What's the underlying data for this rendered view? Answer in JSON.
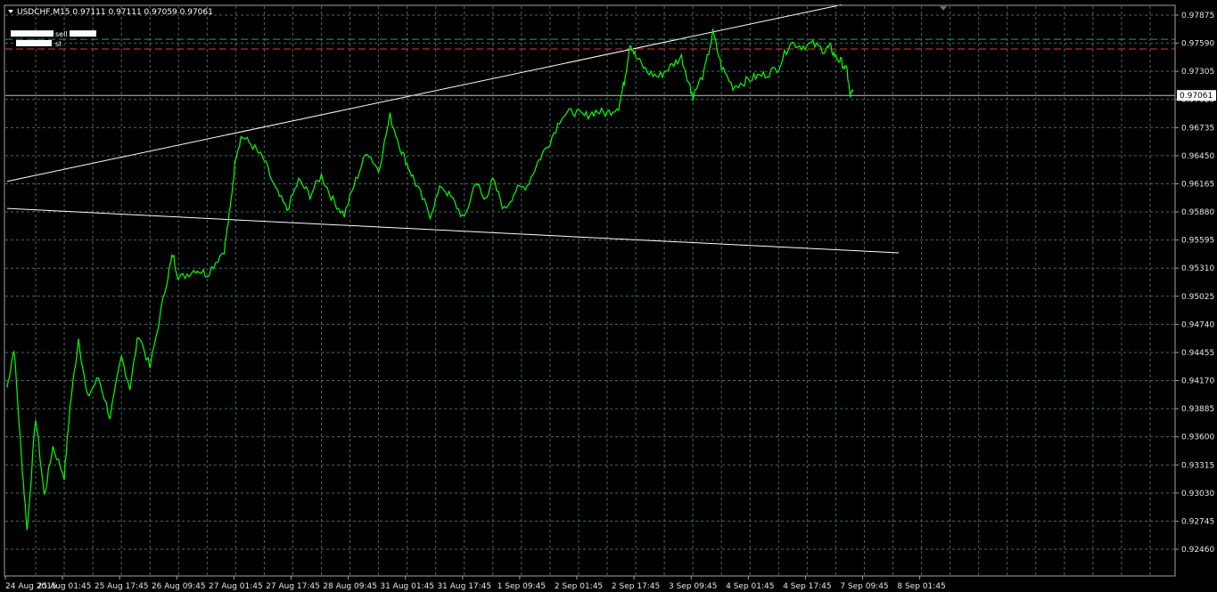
{
  "header": {
    "symbol_line": "USDCHF,M15  0.97111 0.97111 0.97059 0.97061"
  },
  "orders": [
    {
      "label": "sell",
      "price": 0.9763,
      "color": "#00b050"
    },
    {
      "label": "sl",
      "price": 0.97532,
      "color": "#d93b3b"
    }
  ],
  "current_price": {
    "label": "0.97061",
    "value": 0.97061,
    "color": "#ffffff"
  },
  "colors": {
    "background": "#000000",
    "grid": "#3f6b6b",
    "price": "#00ff00",
    "axis_text": "#e6e6e6"
  },
  "icons": [
    "dropdown-triangle-icon"
  ],
  "chart_data": {
    "type": "line",
    "title": "",
    "xlabel": "",
    "ylabel": "",
    "ylim": [
      0.9246,
      0.97875
    ],
    "grid": true,
    "y_ticks": [
      "0.97875",
      "0.97590",
      "0.97305",
      "0.97020",
      "0.96735",
      "0.96450",
      "0.96165",
      "0.95880",
      "0.95595",
      "0.95310",
      "0.95025",
      "0.94740",
      "0.94455",
      "0.94170",
      "0.93885",
      "0.93600",
      "0.93315",
      "0.93030",
      "0.92745",
      "0.92460"
    ],
    "x_ticks": [
      "24 Aug 2015",
      "25 Aug 01:45",
      "25 Aug 17:45",
      "26 Aug 09:45",
      "27 Aug 01:45",
      "27 Aug 17:45",
      "28 Aug 09:45",
      "31 Aug 01:45",
      "31 Aug 17:45",
      "1 Sep 09:45",
      "2 Sep 01:45",
      "2 Sep 17:45",
      "3 Sep 09:45",
      "4 Sep 01:45",
      "4 Sep 17:45",
      "7 Sep 09:45",
      "8 Sep 01:45"
    ],
    "series": [
      {
        "points": [
          [
            0,
            0.941
          ],
          [
            0.12,
            0.945
          ],
          [
            0.25,
            0.934
          ],
          [
            0.35,
            0.9265
          ],
          [
            0.5,
            0.938
          ],
          [
            0.65,
            0.93
          ],
          [
            0.8,
            0.935
          ],
          [
            1.0,
            0.932
          ],
          [
            1.1,
            0.939
          ],
          [
            1.25,
            0.946
          ],
          [
            1.4,
            0.94
          ],
          [
            1.6,
            0.942
          ],
          [
            1.8,
            0.938
          ],
          [
            2.0,
            0.944
          ],
          [
            2.15,
            0.941
          ],
          [
            2.3,
            0.9465
          ],
          [
            2.5,
            0.943
          ],
          [
            2.8,
            0.952
          ],
          [
            2.9,
            0.9545
          ],
          [
            3.0,
            0.952
          ],
          [
            3.3,
            0.953
          ],
          [
            3.5,
            0.9525
          ],
          [
            3.8,
            0.955
          ],
          [
            3.9,
            0.959
          ],
          [
            4.0,
            0.9645
          ],
          [
            4.1,
            0.9665
          ],
          [
            4.3,
            0.9655
          ],
          [
            4.5,
            0.964
          ],
          [
            4.7,
            0.961
          ],
          [
            4.9,
            0.959
          ],
          [
            5.1,
            0.962
          ],
          [
            5.3,
            0.9605
          ],
          [
            5.5,
            0.9625
          ],
          [
            5.7,
            0.96
          ],
          [
            5.9,
            0.9585
          ],
          [
            6.1,
            0.962
          ],
          [
            6.3,
            0.965
          ],
          [
            6.5,
            0.963
          ],
          [
            6.7,
            0.9685
          ],
          [
            6.9,
            0.965
          ],
          [
            7.05,
            0.963
          ],
          [
            7.2,
            0.961
          ],
          [
            7.4,
            0.9585
          ],
          [
            7.6,
            0.9615
          ],
          [
            7.8,
            0.96
          ],
          [
            8.0,
            0.958
          ],
          [
            8.2,
            0.962
          ],
          [
            8.35,
            0.96
          ],
          [
            8.5,
            0.962
          ],
          [
            8.7,
            0.959
          ],
          [
            8.9,
            0.961
          ],
          [
            9.1,
            0.9615
          ],
          [
            9.3,
            0.964
          ],
          [
            9.5,
            0.966
          ],
          [
            9.7,
            0.9685
          ],
          [
            9.9,
            0.969
          ],
          [
            10.1,
            0.9685
          ],
          [
            10.3,
            0.969
          ],
          [
            10.5,
            0.9688
          ],
          [
            10.7,
            0.9695
          ],
          [
            10.8,
            0.972
          ],
          [
            10.9,
            0.976
          ],
          [
            11.0,
            0.9745
          ],
          [
            11.2,
            0.973
          ],
          [
            11.4,
            0.9725
          ],
          [
            11.6,
            0.9735
          ],
          [
            11.8,
            0.9745
          ],
          [
            11.95,
            0.9715
          ],
          [
            12.0,
            0.9705
          ],
          [
            12.2,
            0.973
          ],
          [
            12.35,
            0.977
          ],
          [
            12.5,
            0.9735
          ],
          [
            12.7,
            0.9715
          ],
          [
            12.9,
            0.972
          ],
          [
            13.1,
            0.9725
          ],
          [
            13.3,
            0.9728
          ],
          [
            13.5,
            0.9735
          ],
          [
            13.7,
            0.976
          ],
          [
            13.9,
            0.9756
          ],
          [
            14.1,
            0.9758
          ],
          [
            14.3,
            0.9752
          ],
          [
            14.4,
            0.9755
          ],
          [
            14.5,
            0.9745
          ],
          [
            14.6,
            0.974
          ],
          [
            14.7,
            0.973
          ],
          [
            14.75,
            0.9705
          ],
          [
            14.8,
            0.971
          ]
        ]
      }
    ],
    "trendlines": [
      {
        "from": [
          0.0,
          0.9619
        ],
        "to": [
          14.6,
          0.9798
        ]
      },
      {
        "from": [
          0.0,
          0.95915
        ],
        "to": [
          15.6,
          0.95465
        ]
      }
    ]
  }
}
